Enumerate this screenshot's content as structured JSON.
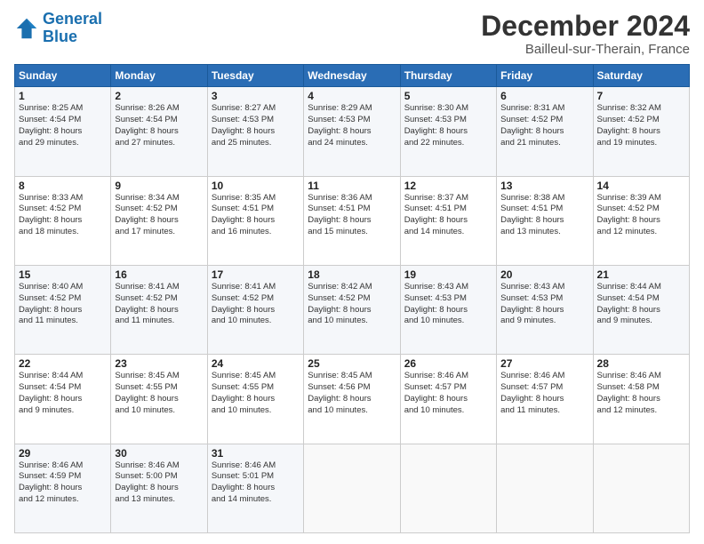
{
  "header": {
    "logo_line1": "General",
    "logo_line2": "Blue",
    "month": "December 2024",
    "location": "Bailleul-sur-Therain, France"
  },
  "weekdays": [
    "Sunday",
    "Monday",
    "Tuesday",
    "Wednesday",
    "Thursday",
    "Friday",
    "Saturday"
  ],
  "weeks": [
    [
      {
        "day": "1",
        "info": "Sunrise: 8:25 AM\nSunset: 4:54 PM\nDaylight: 8 hours\nand 29 minutes."
      },
      {
        "day": "2",
        "info": "Sunrise: 8:26 AM\nSunset: 4:54 PM\nDaylight: 8 hours\nand 27 minutes."
      },
      {
        "day": "3",
        "info": "Sunrise: 8:27 AM\nSunset: 4:53 PM\nDaylight: 8 hours\nand 25 minutes."
      },
      {
        "day": "4",
        "info": "Sunrise: 8:29 AM\nSunset: 4:53 PM\nDaylight: 8 hours\nand 24 minutes."
      },
      {
        "day": "5",
        "info": "Sunrise: 8:30 AM\nSunset: 4:53 PM\nDaylight: 8 hours\nand 22 minutes."
      },
      {
        "day": "6",
        "info": "Sunrise: 8:31 AM\nSunset: 4:52 PM\nDaylight: 8 hours\nand 21 minutes."
      },
      {
        "day": "7",
        "info": "Sunrise: 8:32 AM\nSunset: 4:52 PM\nDaylight: 8 hours\nand 19 minutes."
      }
    ],
    [
      {
        "day": "8",
        "info": "Sunrise: 8:33 AM\nSunset: 4:52 PM\nDaylight: 8 hours\nand 18 minutes."
      },
      {
        "day": "9",
        "info": "Sunrise: 8:34 AM\nSunset: 4:52 PM\nDaylight: 8 hours\nand 17 minutes."
      },
      {
        "day": "10",
        "info": "Sunrise: 8:35 AM\nSunset: 4:51 PM\nDaylight: 8 hours\nand 16 minutes."
      },
      {
        "day": "11",
        "info": "Sunrise: 8:36 AM\nSunset: 4:51 PM\nDaylight: 8 hours\nand 15 minutes."
      },
      {
        "day": "12",
        "info": "Sunrise: 8:37 AM\nSunset: 4:51 PM\nDaylight: 8 hours\nand 14 minutes."
      },
      {
        "day": "13",
        "info": "Sunrise: 8:38 AM\nSunset: 4:51 PM\nDaylight: 8 hours\nand 13 minutes."
      },
      {
        "day": "14",
        "info": "Sunrise: 8:39 AM\nSunset: 4:52 PM\nDaylight: 8 hours\nand 12 minutes."
      }
    ],
    [
      {
        "day": "15",
        "info": "Sunrise: 8:40 AM\nSunset: 4:52 PM\nDaylight: 8 hours\nand 11 minutes."
      },
      {
        "day": "16",
        "info": "Sunrise: 8:41 AM\nSunset: 4:52 PM\nDaylight: 8 hours\nand 11 minutes."
      },
      {
        "day": "17",
        "info": "Sunrise: 8:41 AM\nSunset: 4:52 PM\nDaylight: 8 hours\nand 10 minutes."
      },
      {
        "day": "18",
        "info": "Sunrise: 8:42 AM\nSunset: 4:52 PM\nDaylight: 8 hours\nand 10 minutes."
      },
      {
        "day": "19",
        "info": "Sunrise: 8:43 AM\nSunset: 4:53 PM\nDaylight: 8 hours\nand 10 minutes."
      },
      {
        "day": "20",
        "info": "Sunrise: 8:43 AM\nSunset: 4:53 PM\nDaylight: 8 hours\nand 9 minutes."
      },
      {
        "day": "21",
        "info": "Sunrise: 8:44 AM\nSunset: 4:54 PM\nDaylight: 8 hours\nand 9 minutes."
      }
    ],
    [
      {
        "day": "22",
        "info": "Sunrise: 8:44 AM\nSunset: 4:54 PM\nDaylight: 8 hours\nand 9 minutes."
      },
      {
        "day": "23",
        "info": "Sunrise: 8:45 AM\nSunset: 4:55 PM\nDaylight: 8 hours\nand 10 minutes."
      },
      {
        "day": "24",
        "info": "Sunrise: 8:45 AM\nSunset: 4:55 PM\nDaylight: 8 hours\nand 10 minutes."
      },
      {
        "day": "25",
        "info": "Sunrise: 8:45 AM\nSunset: 4:56 PM\nDaylight: 8 hours\nand 10 minutes."
      },
      {
        "day": "26",
        "info": "Sunrise: 8:46 AM\nSunset: 4:57 PM\nDaylight: 8 hours\nand 10 minutes."
      },
      {
        "day": "27",
        "info": "Sunrise: 8:46 AM\nSunset: 4:57 PM\nDaylight: 8 hours\nand 11 minutes."
      },
      {
        "day": "28",
        "info": "Sunrise: 8:46 AM\nSunset: 4:58 PM\nDaylight: 8 hours\nand 12 minutes."
      }
    ],
    [
      {
        "day": "29",
        "info": "Sunrise: 8:46 AM\nSunset: 4:59 PM\nDaylight: 8 hours\nand 12 minutes."
      },
      {
        "day": "30",
        "info": "Sunrise: 8:46 AM\nSunset: 5:00 PM\nDaylight: 8 hours\nand 13 minutes."
      },
      {
        "day": "31",
        "info": "Sunrise: 8:46 AM\nSunset: 5:01 PM\nDaylight: 8 hours\nand 14 minutes."
      },
      null,
      null,
      null,
      null
    ]
  ]
}
